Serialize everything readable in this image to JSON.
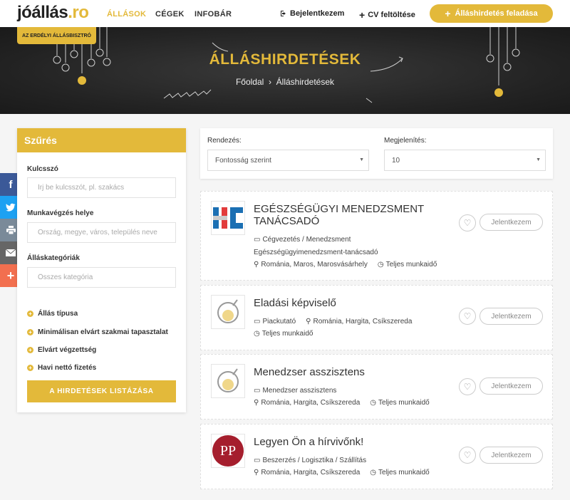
{
  "header": {
    "logo_text": "jóállás",
    "logo_dot": ".ro",
    "nav": [
      {
        "label": "ÁLLÁSOK"
      },
      {
        "label": "CÉGEK"
      },
      {
        "label": "INFOBÁR"
      }
    ],
    "login_label": "Bejelentkezem",
    "cv_label": "CV feltöltése",
    "post_label": "Álláshirdetés feladása"
  },
  "hero": {
    "tag": "AZ ERDÉLYI ÁLLÁSBISZTRÓ",
    "title": "ÁLLÁSHIRDETÉSEK",
    "crumb_home": "Főoldal",
    "crumb_sep": "›",
    "crumb_current": "Álláshirdetések"
  },
  "filter": {
    "title": "Szűrés",
    "keyword_label": "Kulcsszó",
    "keyword_placeholder": "Írj be kulcsszót, pl. szakács",
    "location_label": "Munkavégzés helye",
    "location_placeholder": "Ország, megye, város, település neve",
    "category_label": "Álláskategóriák",
    "category_placeholder": "Összes kategória",
    "expanders": [
      {
        "label": "Állás típusa"
      },
      {
        "label": "Minimálisan elvárt szakmai tapasztalat"
      },
      {
        "label": "Elvárt végzettség"
      },
      {
        "label": "Havi nettó fizetés"
      }
    ],
    "submit_label": "A HIRDETÉSEK LISTÁZÁSA"
  },
  "sort": {
    "order_label": "Rendezés:",
    "order_value": "Fontosság szerint",
    "display_label": "Megjelenítés:",
    "display_value": "10"
  },
  "jobs": [
    {
      "title": "EGÉSZSÉGÜGYI MENEDZSMENT TANÁCSADÓ",
      "category": "Cégvezetés / Menedzsment",
      "company": "Egészségügyimenedzsment-tanácsadó",
      "location": "Románia, Maros, Marosvásárhely",
      "type": "Teljes munkaidő",
      "apply_label": "Jelentkezem"
    },
    {
      "title": "Eladási képviselő",
      "category": "Piackutató",
      "location": "Románia, Hargita, Csíkszereda",
      "type": "Teljes munkaidő",
      "apply_label": "Jelentkezem"
    },
    {
      "title": "Menedzser asszisztens",
      "category": "Menedzser asszisztens",
      "location": "Románia, Hargita, Csíkszereda",
      "type": "Teljes munkaidő",
      "apply_label": "Jelentkezem"
    },
    {
      "title": "Legyen Ön a hírvivőnk!",
      "category": "Beszerzés / Logisztika / Szállítás",
      "location": "Románia, Hargita, Csíkszereda",
      "type": "Teljes munkaidő",
      "apply_label": "Jelentkezem",
      "logo_text": "PP"
    }
  ],
  "colors": {
    "accent": "#e3b93a",
    "facebook": "#3b5998",
    "twitter": "#1da1f2",
    "print": "#7a8a99",
    "email": "#666666",
    "share": "#f26f4f"
  },
  "icons": {
    "social": [
      "facebook-icon",
      "twitter-icon",
      "print-icon",
      "email-icon",
      "share-plus-icon"
    ]
  }
}
